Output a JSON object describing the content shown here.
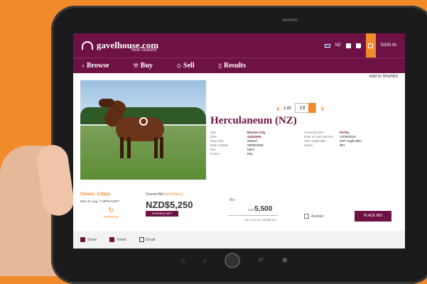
{
  "brand": {
    "name": "gavelhouse.com",
    "sub": "New Zealand"
  },
  "top_right": {
    "country": "NZ",
    "user": "SIGN IN"
  },
  "nav": [
    {
      "label": "Browse"
    },
    {
      "label": "Buy"
    },
    {
      "label": "Sell"
    },
    {
      "label": "Results"
    }
  ],
  "shortlist": "Add to Shortlist",
  "lot": {
    "label": "Lot",
    "number": "19",
    "go": "GO"
  },
  "title": "Herculaneum (NZ)",
  "details_left": [
    {
      "k": "Sire",
      "v": "Elusive City"
    },
    {
      "k": "Dam",
      "v": "Zabalette"
    },
    {
      "k": "Dam Sire",
      "v": "Zabeel"
    },
    {
      "k": "Date Foaled",
      "v": "08/09/2006"
    },
    {
      "k": "Sex",
      "v": "Mare"
    },
    {
      "k": "Colour",
      "v": "Bay"
    }
  ],
  "details_right": [
    {
      "k": "Covering Sire",
      "v": "Perfas"
    },
    {
      "k": "Date of Last Service",
      "v": "12/09/2016"
    },
    {
      "k": "GST Applicable",
      "v": "GST Applicable"
    },
    {
      "k": "Views",
      "v": "867"
    }
  ],
  "closes": {
    "label": "Closes: 4 Days",
    "date": "Mon 21 Aug, 7:19PM NZST",
    "refresh": "REFRESH"
  },
  "current_bid": {
    "label": "Current Bid",
    "history": "(bid history)",
    "value": "NZD$5,250",
    "reserve": "RESERVE MET"
  },
  "your_bid": {
    "label": "Bid",
    "prefix": "NZD",
    "value": "5,500",
    "min": "Min next bid: NZD$5,500"
  },
  "autobid": "Autobid",
  "place_bid": "PLACE BID",
  "footer": {
    "share": "Share",
    "tweet": "Tweet",
    "email": "Email"
  },
  "colors": {
    "brand": "#6e1245",
    "accent": "#f08a2a"
  }
}
